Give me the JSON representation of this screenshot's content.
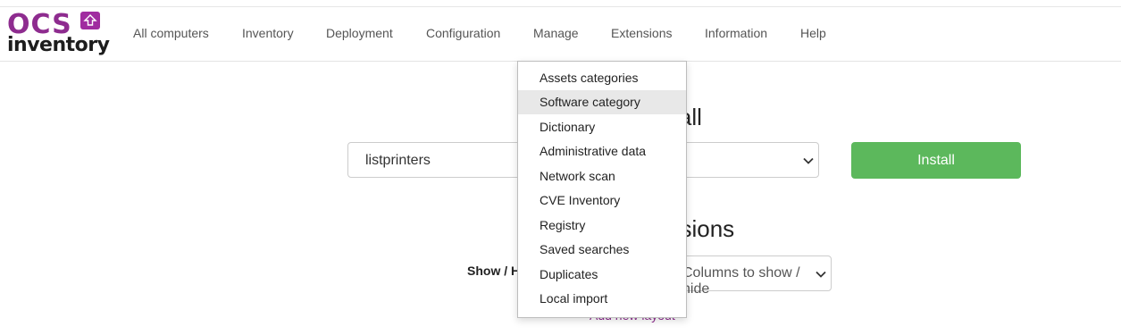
{
  "brand": {
    "ocs": "OCS",
    "inventory": "inventory",
    "color": "#8e2c8f"
  },
  "nav": {
    "items": [
      "All computers",
      "Inventory",
      "Deployment",
      "Configuration",
      "Manage",
      "Extensions",
      "Information",
      "Help"
    ]
  },
  "install_section": {
    "heading": "Install",
    "package_value": "listprinters",
    "install_label": "Install",
    "button_color": "#5cb85c"
  },
  "extensions_section": {
    "heading": "Extensions",
    "show_hide_label": "Show / Hide",
    "columns_placeholder": "Columns to show / hide",
    "add_layout": "Add new layout"
  },
  "manage_menu": {
    "items": [
      "Assets categories",
      "Software category",
      "Dictionary",
      "Administrative data",
      "Network scan",
      "CVE Inventory",
      "Registry",
      "Saved searches",
      "Duplicates",
      "Local import"
    ],
    "highlighted": "Software category"
  },
  "icons": [
    "logo-upload-icon",
    "chevron-down-icon"
  ]
}
